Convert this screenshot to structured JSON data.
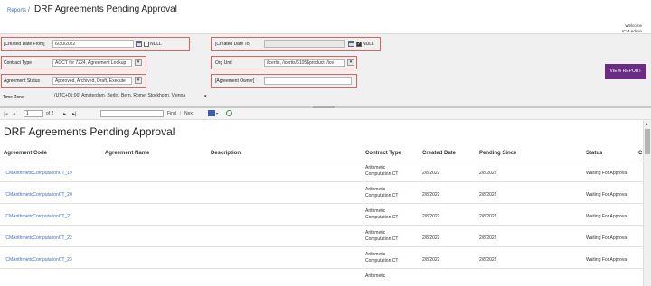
{
  "header": {
    "breadcrumb_reports": "Reports",
    "breadcrumb_sep": "/",
    "title": "DRF Agreements Pending Approval",
    "welcome": "Welcome",
    "user": "ICM Admin"
  },
  "params": {
    "created_from_label": "[Created Date From]",
    "created_from_value": "6/30/2022",
    "created_to_label": "[Created Date To]",
    "created_to_value": "",
    "null_label": "NULL",
    "contract_type_label": "Contract Type",
    "contract_type_value": "AGCT for 7224, Agreement Lookup",
    "org_unit_label": "Org Unit",
    "org_unit_value": "/icertis, /icertis/6105$product, /ice",
    "agreement_status_label": "Agreement Status",
    "agreement_status_value": "Approved, Archived, Draft, Execute",
    "agreement_owner_label": "[Agreement Owner]",
    "agreement_owner_value": "",
    "time_zone_label": "Time Zone",
    "time_zone_value": "(UTC+01:00) Amsterdam, Berlin, Bern, Rome, Stockholm, Vienna",
    "view_report": "VIEW REPORT",
    "splitter_label": "......"
  },
  "toolbar": {
    "page": "1",
    "of_pages": "of 2",
    "find": "Find",
    "separator": "|",
    "next": "Next"
  },
  "report": {
    "title": "DRF Agreements Pending Approval",
    "columns": [
      "Agreement Code",
      "Agreement Name",
      "Description",
      "Contract Type",
      "Created Date",
      "Pending Since",
      "Status",
      "C"
    ],
    "rows": [
      {
        "code": "ICMArithmeticComputationCT_19",
        "type1": "Arithmetic",
        "type2": "Computation CT",
        "created": "2/8/2022",
        "pending": "2/8/2022",
        "status": "Waiting For Approval"
      },
      {
        "code": "ICMArithmeticComputationCT_20",
        "type1": "Arithmetic",
        "type2": "Computation CT",
        "created": "2/8/2022",
        "pending": "2/8/2022",
        "status": "Waiting For Approval"
      },
      {
        "code": "ICMArithmeticComputationCT_21",
        "type1": "Arithmetic",
        "type2": "Computation CT",
        "created": "2/8/2022",
        "pending": "2/8/2022",
        "status": "Waiting For Approval"
      },
      {
        "code": "ICMArithmeticComputationCT_22",
        "type1": "Arithmetic",
        "type2": "Computation CT",
        "created": "2/8/2022",
        "pending": "2/8/2022",
        "status": "Waiting For Approval"
      },
      {
        "code": "ICMArithmeticComputationCT_23",
        "type1": "Arithmetic",
        "type2": "Computation CT",
        "created": "2/8/2022",
        "pending": "2/8/2022",
        "status": "Waiting For Approval"
      },
      {
        "code": "",
        "type1": "Arithmetic",
        "type2": "",
        "created": "",
        "pending": "",
        "status": ""
      }
    ]
  },
  "colors": {
    "accent": "#6b2c86",
    "link": "#3a6fb6",
    "highlight_border": "#e06060"
  },
  "icons": [
    "calendar-icon",
    "dropdown-icon",
    "first-page-icon",
    "prev-page-icon",
    "next-page-icon",
    "last-page-icon",
    "export-icon",
    "refresh-icon"
  ]
}
